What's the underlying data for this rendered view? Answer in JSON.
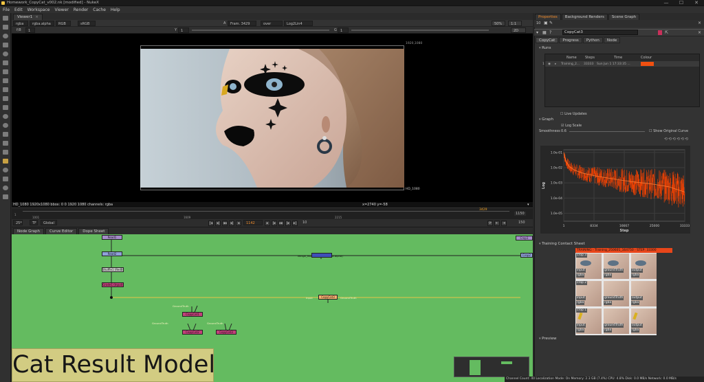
{
  "window": {
    "title": "Homework_CopyCat_v002.nk [modified] - NukeX",
    "controls": [
      "—",
      "☐",
      "✕"
    ]
  },
  "menu": [
    "File",
    "Edit",
    "Workspace",
    "Viewer",
    "Render",
    "Cache",
    "Help"
  ],
  "viewer_tab": {
    "label": "Viewer1"
  },
  "viewer_controls": {
    "layer": "rgba",
    "channel": "rgba.alpha",
    "colorspace": "RGB",
    "display": "sRGB",
    "input_a": "A",
    "frame_label": "Fram. 3429",
    "input_b_off": "-B",
    "wipe": "over",
    "b_node": "Log2Lin4",
    "fstop": "f/8",
    "frame_a": "1",
    "y_label": "Y",
    "y_value": "1",
    "gain_label": "G",
    "fps_label": "1",
    "zoom": "50%",
    "aspect": "1:1",
    "mode": "2D"
  },
  "viewer_image": {
    "format_top": "1920,1080",
    "format_bottom": "HD_1080"
  },
  "viewer_info": {
    "left": "HD_1080 1920x1080  bbox: 0 0 1920 1080 channels: rgba",
    "coords": "x=2740 y=-58"
  },
  "timeline": {
    "ticks": [
      "1",
      "1001",
      "1609",
      "2215",
      "2822",
      "3429",
      "1150"
    ],
    "start_label": "1",
    "end_label": "1150",
    "marker": "3429"
  },
  "transport": {
    "fps": "25*",
    "tf": "TF",
    "global": "Global",
    "frame": "1142",
    "step": "10",
    "end": "150"
  },
  "graph_tabs": [
    "Node Graph",
    "Curve Editor",
    "Dope Sheet"
  ],
  "nodes": {
    "read": "Read1",
    "dot1": "Read2",
    "shuffle": "Shuffle1 (RedBlu)",
    "grade": "Grade1 (Input)",
    "long_node": "Merge_Multiply_alpha (rgba.alpha)",
    "copycat": "CopyCat3",
    "input_lbl": "Input",
    "gt_lbl": "GroundTruth",
    "inf1": "CopyCat1",
    "inf2": "CopyCat2",
    "inf3": "CopyCat3",
    "gt_a": "GroundTruth",
    "gt_b": "GroundTruth",
    "gt_c": "GroundTruth",
    "right_top": "Crop1",
    "right_mid": "Crop2"
  },
  "big_label": "Cat Result Model",
  "status_bar": "Channel Count: 40  Localization Mode: On  Memory: 2.3 GB (7.4%)  CPU: 4.8%  Disk: 0.0 MB/s  Network: 0.0 MB/s",
  "right_panel": {
    "tabs": [
      "Properties",
      "Background Renders",
      "Scene Graph"
    ],
    "toolbar_count": "10",
    "node_name": "CopyCat3",
    "node_tabs": [
      "CopyCat",
      "Progress",
      "Python",
      "Node"
    ],
    "runs_section": "Runs",
    "runs_headers": [
      "Name",
      "Steps",
      "Time",
      "Colour"
    ],
    "run_row": {
      "index": "1",
      "name": "Training_2...",
      "steps": "33333",
      "time": "Sun Jun  1 17:33:35 ...",
      "colour": "#f05010"
    },
    "live_updates": "Live Updates",
    "graph_section": "Graph",
    "log_scale": "Log Scale",
    "smoothness_label": "Smoothness",
    "smoothness_value": "0.6",
    "show_original": "Show Original Curve",
    "contact_section": "Training Contact Sheet",
    "contact_title": "TRAINING - Training_250601_164750 - STEP: 33300",
    "contact_rows": [
      {
        "crop": "crop 3",
        "labels": [
          "input",
          "groundTruth",
          "output"
        ],
        "sub": [
          "rgba",
          "rgba",
          "rgba"
        ]
      },
      {
        "crop": "crop 2",
        "labels": [
          "input",
          "groundTruth",
          "output"
        ],
        "sub": [
          "rgba",
          "rgba",
          "rgba"
        ]
      },
      {
        "crop": "crop 1",
        "labels": [
          "input",
          "groundTruth",
          "output"
        ],
        "sub": [
          "rgba",
          "rgba",
          "rgba"
        ]
      }
    ],
    "preview_section": "Preview"
  },
  "colors": {
    "accent": "#f08a2a",
    "graph_bg": "#64bb60",
    "node_pink": "#c2407a",
    "node_purple": "#a58bc9",
    "node_blue": "#3f4fb8",
    "node_orange": "#f5b070",
    "loss_curve": "#ff4400"
  },
  "chart_data": {
    "type": "line",
    "title": "",
    "xlabel": "Step",
    "ylabel": "Log",
    "x_ticks": [
      "1",
      "8334",
      "16667",
      "25000",
      "33333"
    ],
    "y_ticks": [
      "1.0e-01",
      "1.0e-02",
      "1.0e-03",
      "1.0e-04",
      "1.0e-05"
    ],
    "log_scale": true,
    "xlim": [
      1,
      33333
    ],
    "ylim": [
      3e-06,
      0.15
    ],
    "series": [
      {
        "x": [
          1,
          500,
          1500,
          3000,
          5000,
          8334,
          12000,
          16667,
          20000,
          25000,
          29000,
          33333
        ],
        "y": [
          0.1,
          0.03,
          0.012,
          0.007,
          0.0045,
          0.003,
          0.0021,
          0.0014,
          0.0011,
          0.0008,
          0.00055,
          0.00025
        ]
      }
    ]
  }
}
